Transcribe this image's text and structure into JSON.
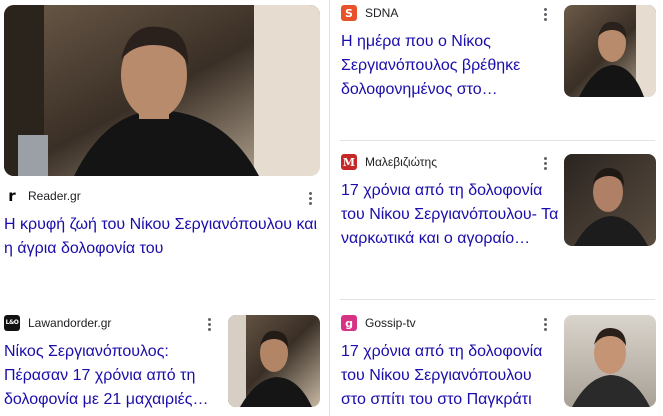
{
  "cards": [
    {
      "source": "Reader.gr",
      "favicon": "r",
      "favicon_color": "#ffffff",
      "favicon_text": "#000000",
      "title": "Η κρυφή ζωή του Νίκου Σεργιανόπουλου και η άγρια δολοφονία του"
    },
    {
      "source": "SDNA",
      "favicon": "S",
      "favicon_color": "#e8522b",
      "favicon_text": "#ffffff",
      "title": "Η ημέρα που ο Νίκος Σεργιανόπουλος βρέθηκε δολοφονημένος στο…"
    },
    {
      "source": "Μαλεβιζιώτης",
      "favicon": "M",
      "favicon_color": "#c62828",
      "favicon_text": "#ffffff",
      "title": "17 χρόνια από τη δολοφονία του Νίκου Σεργιανόπουλου- Τα ναρκωτικά και ο αγοραίο…"
    },
    {
      "source": "Lawandorder.gr",
      "favicon": "L&O",
      "favicon_color": "#111111",
      "favicon_text": "#ffffff",
      "title": "Νίκος Σεργιανόπουλος: Πέρασαν 17 χρόνια από τη δολοφονία με 21 μαχαιριές…"
    },
    {
      "source": "Gossip-tv",
      "favicon": "g",
      "favicon_color": "#d63384",
      "favicon_text": "#ffffff",
      "title": "17 χρόνια από τη δολοφονία του Νίκου Σεργιανόπουλου στο σπίτι του στο Παγκράτι"
    }
  ],
  "icons": {
    "menu": "more-vert-icon"
  },
  "colors": {
    "link": "#1a0dab",
    "divider": "#e3e3e3"
  }
}
